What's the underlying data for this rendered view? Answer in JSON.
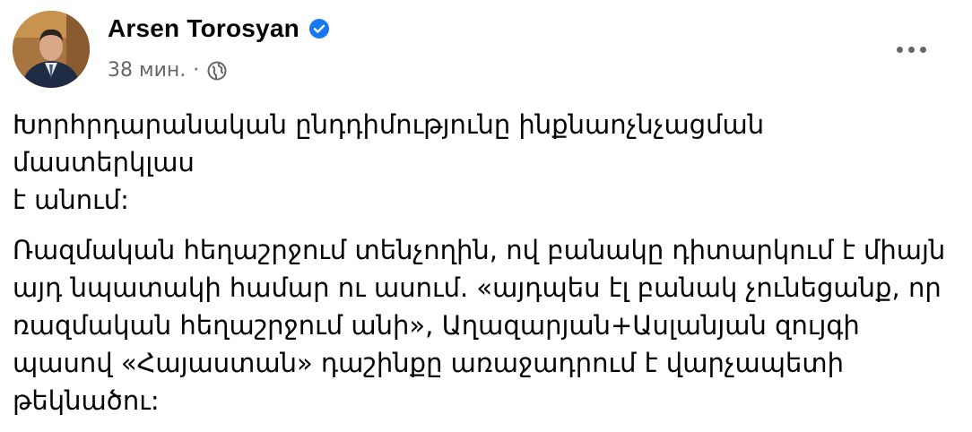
{
  "post": {
    "author": "Arsen Torosyan",
    "time": "38 мин.",
    "separator": "·",
    "icons": {
      "verified": "verified-badge-icon",
      "audience": "globe-icon",
      "menu": "more-options-icon",
      "accent": "#1877f2"
    },
    "paragraphs": [
      "Խորհրդարանական ընդդիմությունը ինքնաոչնչացման մաստերկլաս\nէ անում:",
      "Ռազմական հեղաշրջում տենչողին, ով բանակը դիտարկում է միայն\nայդ նպատակի համար ու ասում. «այդպես էլ բանակ չունեցանք, որ\nռազմական հեղաշրջում անի», Աղազարյան+Ասլանյան զույգի\nպասով «Հայաստան» դաշինքը առաջադրում է վարչապետի\nթեկնածու:"
    ]
  }
}
